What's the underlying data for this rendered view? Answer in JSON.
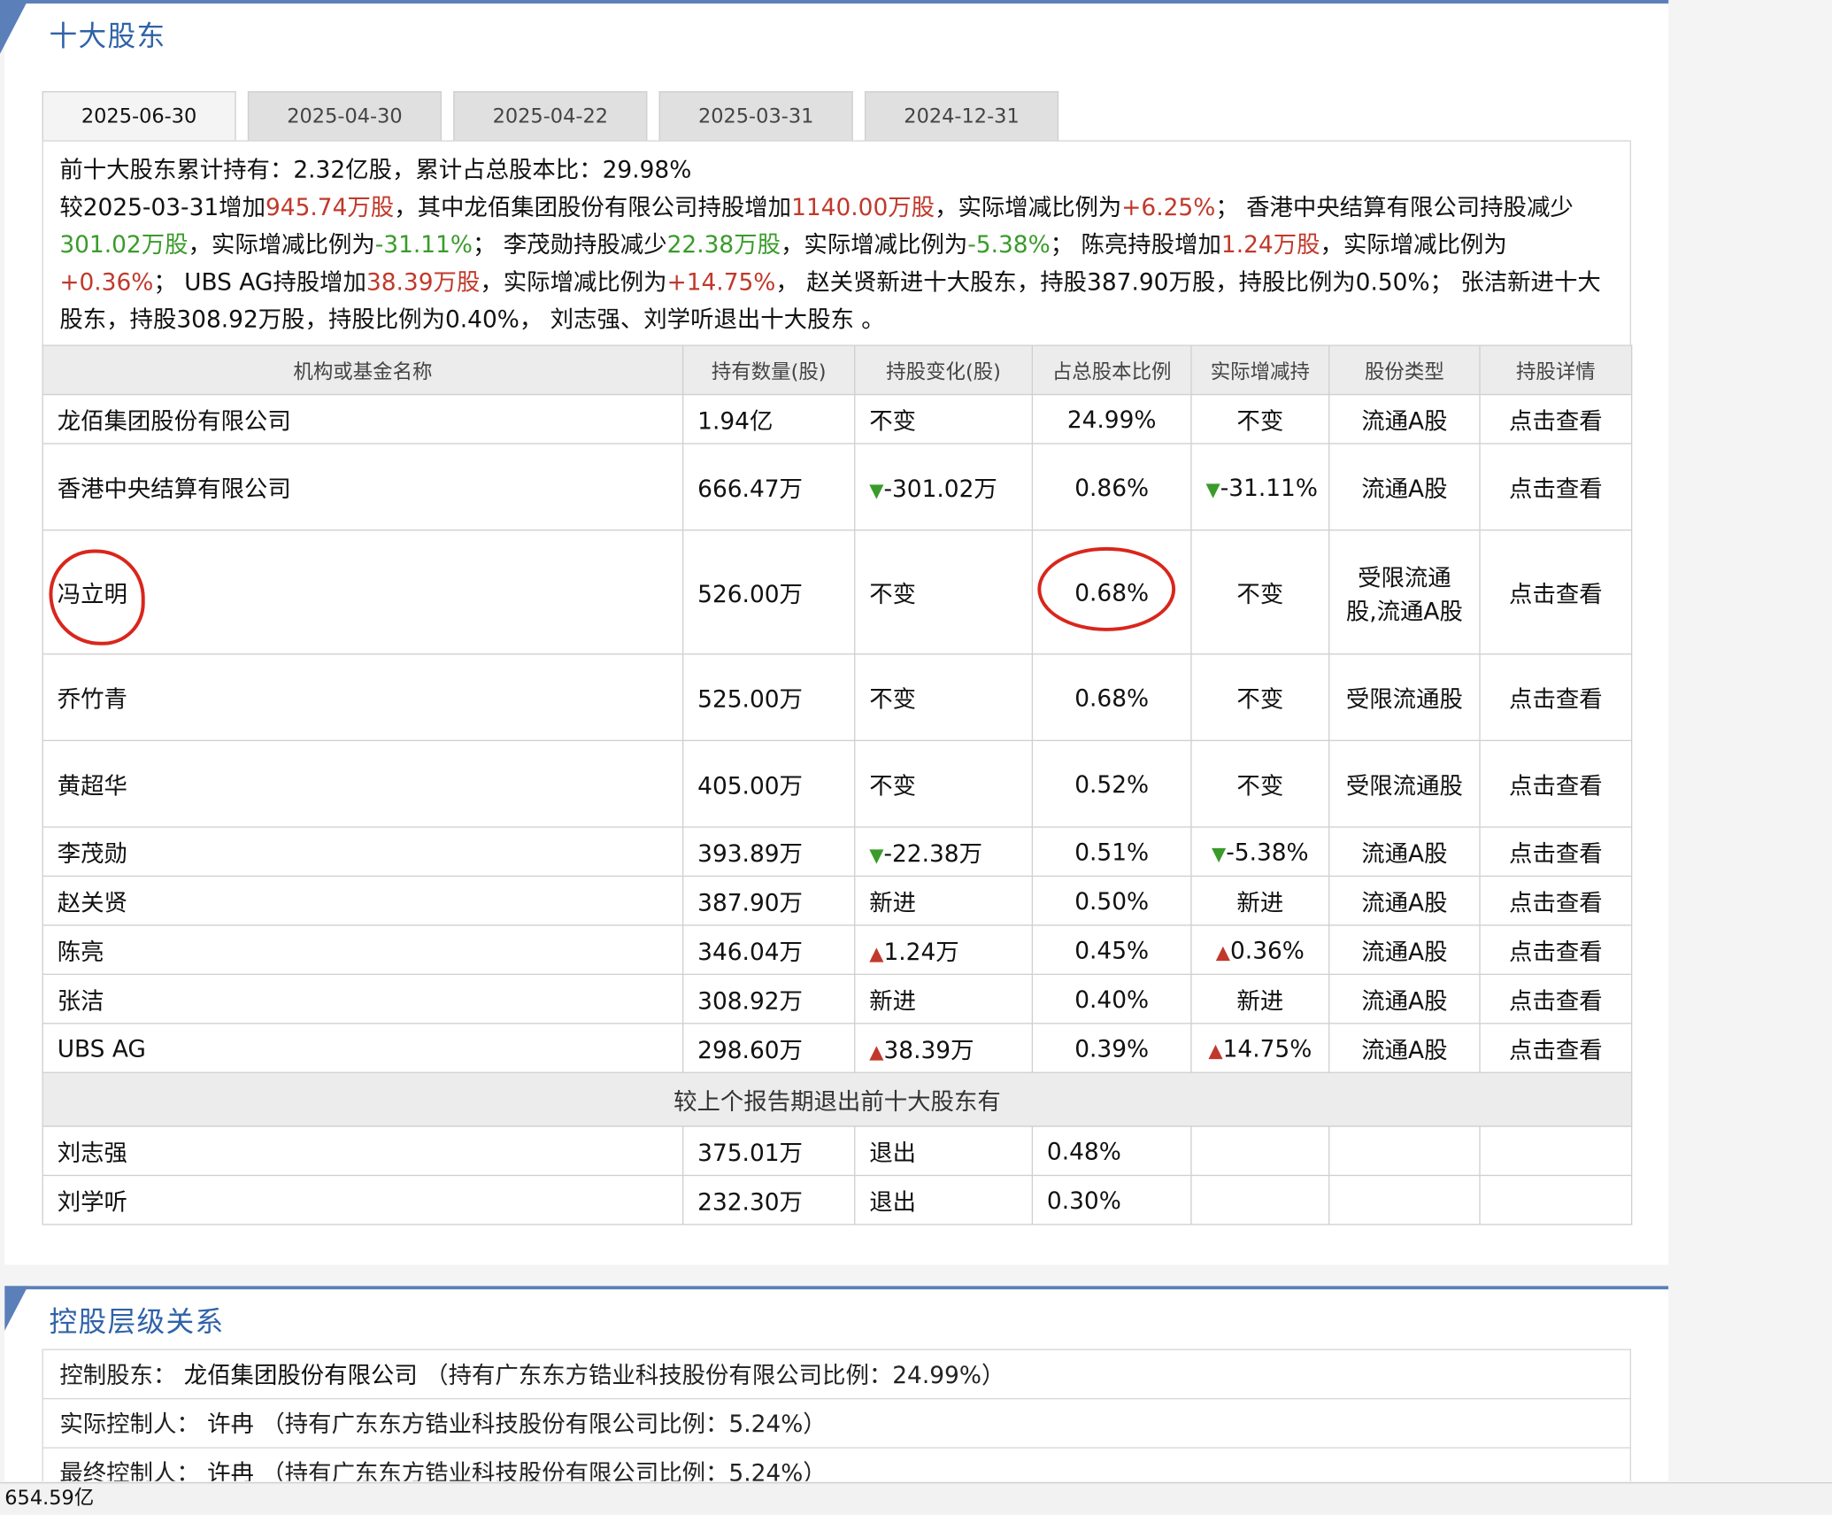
{
  "section1": {
    "title": "十大股东"
  },
  "tabs": [
    "2025-06-30",
    "2025-04-30",
    "2025-04-22",
    "2025-03-31",
    "2024-12-31"
  ],
  "summary": {
    "line1_label": "前十大股东累计持有：",
    "line1_value": "2.32亿股，累计占总股本比：29.98%",
    "p1": "较2025-03-31增加",
    "v1": "945.74万股",
    "p2": "，其中龙佰集团股份有限公司持股增加",
    "v2": "1140.00万股",
    "p3": "，实际增减比例为",
    "v3": "+6.25%",
    "p4": "； 香港中央结算有限公司持股减少",
    "v4": "301.02万股",
    "p5": "，实际增减比例为",
    "v5": "-31.11%",
    "p6": "； 李茂勋持股减少",
    "v6": "22.38万股",
    "p7": "，实际增减比例为",
    "v7": "-5.38%",
    "p8": "； 陈亮持股增加",
    "v8": "1.24万股",
    "p9": "，实际增减比例为",
    "v9": "+0.36%",
    "p10": "； UBS AG持股增加",
    "v10": "38.39万股",
    "p11": "，实际增减比例为",
    "v11": "+14.75%",
    "p12": "， 赵关贤新进十大股东，持股387.90万股，持股比例为0.50%； 张洁新进十大股东，持股308.92万股，持股比例为0.40%， 刘志强、刘学听退出十大股东 。"
  },
  "columns": [
    "机构或基金名称",
    "持有数量(股)",
    "持股变化(股)",
    "占总股本比例",
    "实际增减持",
    "股份类型",
    "持股详情"
  ],
  "rows": [
    {
      "name": "龙佰集团股份有限公司",
      "qty": "1.94亿",
      "change": "不变",
      "change_type": "none",
      "pct": "24.99%",
      "actual": "不变",
      "actual_type": "none",
      "type": "流通A股",
      "detail": "点击查看"
    },
    {
      "name": "香港中央结算有限公司",
      "qty": "666.47万",
      "change": "-301.02万",
      "change_type": "down",
      "pct": "0.86%",
      "actual": "-31.11%",
      "actual_type": "down",
      "type": "流通A股",
      "detail": "点击查看"
    },
    {
      "name": "冯立明",
      "qty": "526.00万",
      "change": "不变",
      "change_type": "none",
      "pct": "0.68%",
      "actual": "不变",
      "actual_type": "none",
      "type": "受限流通股,流通A股",
      "detail": "点击查看"
    },
    {
      "name": "乔竹青",
      "qty": "525.00万",
      "change": "不变",
      "change_type": "none",
      "pct": "0.68%",
      "actual": "不变",
      "actual_type": "none",
      "type": "受限流通股",
      "detail": "点击查看"
    },
    {
      "name": "黄超华",
      "qty": "405.00万",
      "change": "不变",
      "change_type": "none",
      "pct": "0.52%",
      "actual": "不变",
      "actual_type": "none",
      "type": "受限流通股",
      "detail": "点击查看"
    },
    {
      "name": "李茂勋",
      "qty": "393.89万",
      "change": "-22.38万",
      "change_type": "down",
      "pct": "0.51%",
      "actual": "-5.38%",
      "actual_type": "down",
      "type": "流通A股",
      "detail": "点击查看"
    },
    {
      "name": "赵关贤",
      "qty": "387.90万",
      "change": "新进",
      "change_type": "new",
      "pct": "0.50%",
      "actual": "新进",
      "actual_type": "new",
      "type": "流通A股",
      "detail": "点击查看"
    },
    {
      "name": "陈亮",
      "qty": "346.04万",
      "change": "1.24万",
      "change_type": "up",
      "pct": "0.45%",
      "actual": "0.36%",
      "actual_type": "up",
      "type": "流通A股",
      "detail": "点击查看"
    },
    {
      "name": "张洁",
      "qty": "308.92万",
      "change": "新进",
      "change_type": "new",
      "pct": "0.40%",
      "actual": "新进",
      "actual_type": "new",
      "type": "流通A股",
      "detail": "点击查看"
    },
    {
      "name": "UBS AG",
      "qty": "298.60万",
      "change": "38.39万",
      "change_type": "up",
      "pct": "0.39%",
      "actual": "14.75%",
      "actual_type": "up",
      "type": "流通A股",
      "detail": "点击查看"
    }
  ],
  "exit_header": "较上个报告期退出前十大股东有",
  "exits": [
    {
      "name": "刘志强",
      "qty": "375.01万",
      "change": "退出",
      "pct": "0.48%"
    },
    {
      "name": "刘学听",
      "qty": "232.30万",
      "change": "退出",
      "pct": "0.30%"
    }
  ],
  "section2": {
    "title": "控股层级关系",
    "rows": [
      {
        "label": "控制股东：",
        "value": "龙佰集团股份有限公司",
        "note": "（持有广东东方锆业科技股份有限公司比例：24.99%）"
      },
      {
        "label": "实际控制人：",
        "value": "许冉",
        "note": "（持有广东东方锆业科技股份有限公司比例：5.24%）"
      },
      {
        "label": "最终控制人：",
        "value": "许冉",
        "note": "（持有广东东方锆业科技股份有限公司比例：5.24%）"
      }
    ]
  },
  "bottom_bar": "654.59亿",
  "colors": {
    "accent": "#2f62a8",
    "up": "#c0392b",
    "down": "#3a9b2b",
    "annotation": "#d9261c"
  }
}
